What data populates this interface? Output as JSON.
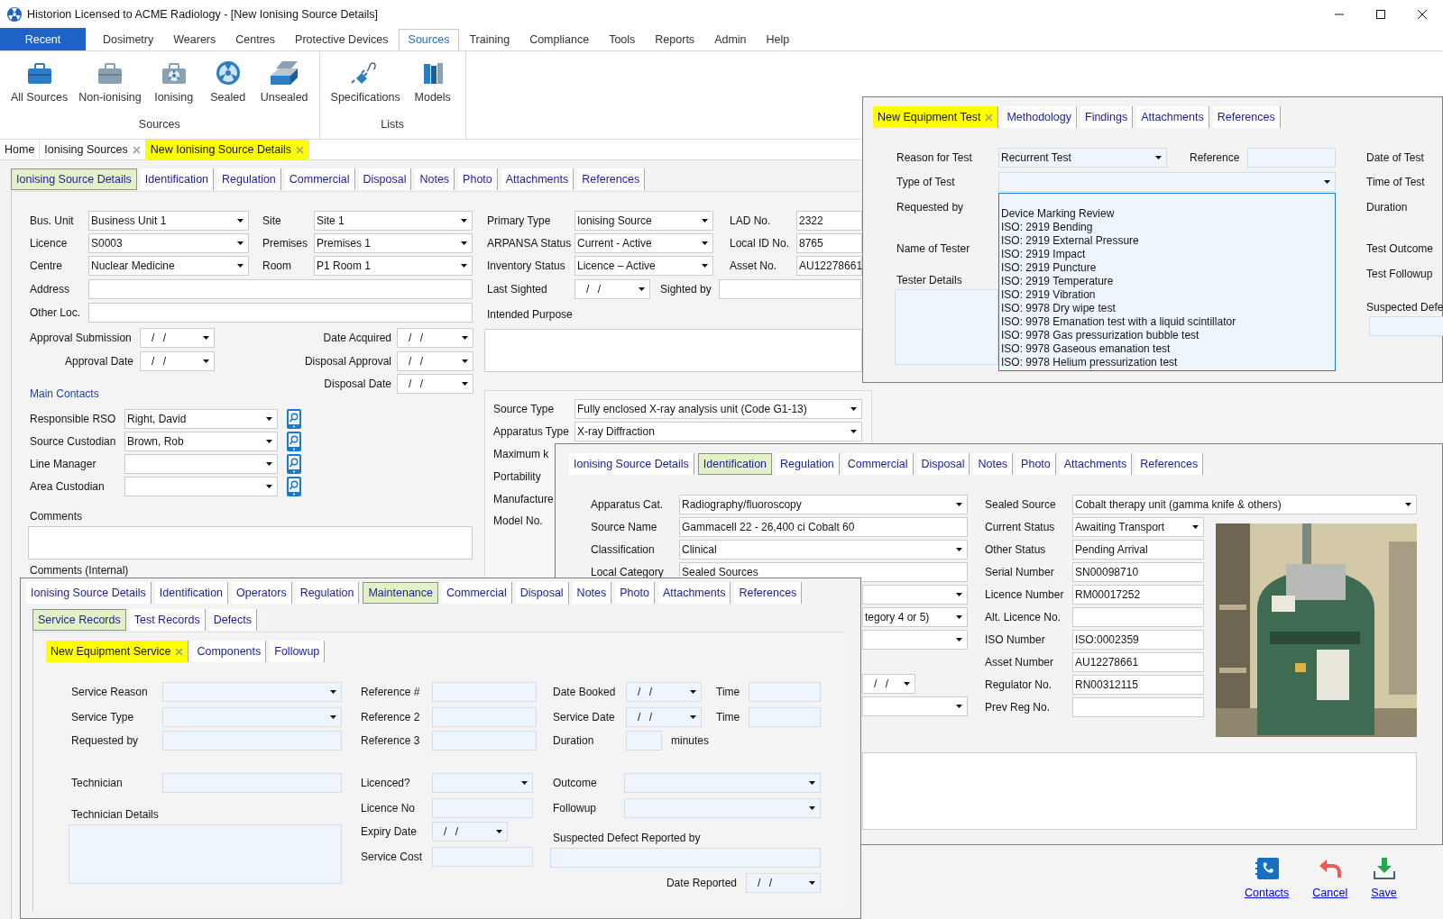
{
  "window": {
    "title": "Historion Licensed to ACME Radiology - [New Ionising Source Details]"
  },
  "menu": {
    "recent": "Recent",
    "tabs": [
      {
        "label": "Dosimetry",
        "selected": false
      },
      {
        "label": "Wearers",
        "selected": false
      },
      {
        "label": "Centres",
        "selected": false
      },
      {
        "label": "Protective Devices",
        "selected": false
      },
      {
        "label": "Sources",
        "selected": true
      },
      {
        "label": "Training",
        "selected": false
      },
      {
        "label": "Compliance",
        "selected": false
      },
      {
        "label": "Tools",
        "selected": false
      },
      {
        "label": "Reports",
        "selected": false
      },
      {
        "label": "Admin",
        "selected": false
      },
      {
        "label": "Help",
        "selected": false
      }
    ]
  },
  "ribbon": {
    "groups": [
      {
        "label": "Sources",
        "items": [
          {
            "label": "All Sources"
          },
          {
            "label": "Non-ionising"
          },
          {
            "label": "Ionising"
          },
          {
            "label": "Sealed"
          },
          {
            "label": "Unsealed"
          }
        ]
      },
      {
        "label": "Lists",
        "items": [
          {
            "label": "Specifications"
          },
          {
            "label": "Models"
          }
        ]
      }
    ]
  },
  "document_tabs": [
    {
      "label": "Home",
      "closable": false,
      "selected": false
    },
    {
      "label": "Ionising Sources",
      "closable": true,
      "selected": false
    },
    {
      "label": "New Ionising Source Details",
      "closable": true,
      "selected": true
    }
  ],
  "source_form": {
    "tabs": [
      {
        "label": "Ionising Source Details",
        "selected": true
      },
      {
        "label": "Identification",
        "selected": false
      },
      {
        "label": "Regulation",
        "selected": false
      },
      {
        "label": "Commercial",
        "selected": false
      },
      {
        "label": "Disposal",
        "selected": false
      },
      {
        "label": "Notes",
        "selected": false
      },
      {
        "label": "Photo",
        "selected": false
      },
      {
        "label": "Attachments",
        "selected": false
      },
      {
        "label": "References",
        "selected": false
      }
    ],
    "fields": [
      {
        "label": "Bus. Unit",
        "kind": "combo",
        "value": "Business Unit 1"
      },
      {
        "label": "Site",
        "kind": "combo",
        "value": "Site 1"
      },
      {
        "label": "Primary Type",
        "kind": "combo",
        "value": "Ionising Source"
      },
      {
        "label": "LAD No.",
        "kind": "text",
        "value": "2322"
      },
      {
        "label": "Licence",
        "kind": "combo",
        "value": "S0003"
      },
      {
        "label": "Premises",
        "kind": "combo",
        "value": "Premises 1"
      },
      {
        "label": "ARPANSA Status",
        "kind": "combo",
        "value": "Current - Active"
      },
      {
        "label": "Local ID No.",
        "kind": "text",
        "value": "8765"
      },
      {
        "label": "Centre",
        "kind": "combo",
        "value": "Nuclear Medicine"
      },
      {
        "label": "Room",
        "kind": "combo",
        "value": "P1 Room 1"
      },
      {
        "label": "Inventory Status",
        "kind": "combo",
        "value": "Licence – Active"
      },
      {
        "label": "Asset No.",
        "kind": "text",
        "value": "AU12278661"
      },
      {
        "label": "Address",
        "kind": "text"
      },
      {
        "label": "Last Sighted",
        "kind": "date",
        "value": "/ /"
      },
      {
        "label": "Sighted by",
        "kind": "text"
      },
      {
        "label": "Other Loc.",
        "kind": "text"
      },
      {
        "label": "Intended Purpose",
        "kind": "area"
      },
      {
        "label": "Approval Submission",
        "kind": "date",
        "value": "/ /"
      },
      {
        "label": "Date Acquired",
        "kind": "date",
        "value": "/ /"
      },
      {
        "label": "Approval Date",
        "kind": "date",
        "value": "/ /"
      },
      {
        "label": "Disposal Approval",
        "kind": "date",
        "value": "/ /"
      },
      {
        "label": "Disposal Date",
        "kind": "date",
        "value": "/ /"
      },
      {
        "label": "Comments",
        "kind": "area"
      },
      {
        "label": "Comments (Internal)",
        "kind": "label"
      }
    ],
    "contacts_heading": "Main Contacts",
    "contacts": [
      {
        "label": "Responsible RSO",
        "value": "Right, David"
      },
      {
        "label": "Source Custodian",
        "value": "Brown, Rob"
      },
      {
        "label": "Line Manager"
      },
      {
        "label": "Area Custodian"
      }
    ],
    "apparatus_fields": [
      {
        "label": "Source Type",
        "kind": "combo",
        "value": "Fully enclosed X-ray analysis unit (Code G1-13)"
      },
      {
        "label": "Apparatus Type",
        "kind": "combo",
        "value": "X-ray Diffraction"
      },
      {
        "label": "Maximum k",
        "kind": "label"
      },
      {
        "label": "Portability",
        "kind": "label"
      },
      {
        "label": "Manufacture",
        "kind": "label"
      },
      {
        "label": "Model No.",
        "kind": "label"
      }
    ]
  },
  "test_window": {
    "tabs": [
      {
        "label": "New Equipment Test",
        "closable": true,
        "selected": true
      },
      {
        "label": "Methodology",
        "closable": false,
        "selected": false
      },
      {
        "label": "Findings",
        "closable": false,
        "selected": false
      },
      {
        "label": "Attachments",
        "closable": false,
        "selected": false
      },
      {
        "label": "References",
        "closable": false,
        "selected": false
      }
    ],
    "fields": [
      {
        "label": "Reason for Test",
        "kind": "combo",
        "value": "Recurrent Test"
      },
      {
        "label": "Reference",
        "kind": "text"
      },
      {
        "label": "Date of Test",
        "kind": "label"
      },
      {
        "label": "Type of Test",
        "kind": "combo"
      },
      {
        "label": "Time of Test",
        "kind": "label"
      },
      {
        "label": "Requested by",
        "kind": "label"
      },
      {
        "label": "Duration",
        "kind": "label"
      },
      {
        "label": "Name of Tester",
        "kind": "label"
      },
      {
        "label": "Test Outcome",
        "kind": "label"
      },
      {
        "label": "Tester Details",
        "kind": "area"
      },
      {
        "label": "Test Followup",
        "kind": "label"
      },
      {
        "label": "Suspected Defe",
        "kind": "text"
      }
    ],
    "type_options": [
      "Device Marking Review",
      "ISO: 2919 Bending",
      "ISO: 2919 External Pressure",
      "ISO: 2919 Impact",
      "ISO: 2919 Puncture",
      "ISO: 2919 Temperature",
      "ISO: 2919 Vibration",
      "ISO: 9978 Dry wipe test",
      "ISO: 9978 Emanation test with a liquid scintillator",
      "ISO: 9978 Gas pressurization bubble test",
      "ISO: 9978 Gaseous emanation test",
      "ISO: 9978 Helium pressurization test"
    ]
  },
  "identification_window": {
    "tabs": [
      {
        "label": "Ionising Source Details",
        "selected": false
      },
      {
        "label": "Identification",
        "selected": true
      },
      {
        "label": "Regulation",
        "selected": false
      },
      {
        "label": "Commercial",
        "selected": false
      },
      {
        "label": "Disposal",
        "selected": false
      },
      {
        "label": "Notes",
        "selected": false
      },
      {
        "label": "Photo",
        "selected": false
      },
      {
        "label": "Attachments",
        "selected": false
      },
      {
        "label": "References",
        "selected": false
      }
    ],
    "fields": [
      {
        "label": "Apparatus Cat.",
        "kind": "combo",
        "value": "Radiography/fluoroscopy"
      },
      {
        "label": "Source Name",
        "kind": "text",
        "value": "Gammacell 22 - 26,400 ci Cobalt 60"
      },
      {
        "label": "Classification",
        "kind": "combo",
        "value": "Clinical"
      },
      {
        "label": "Local Category",
        "kind": "text",
        "value": "Sealed Sources"
      },
      {
        "kind": "combo"
      },
      {
        "kind": "combo",
        "value": "tegory 4 or 5)"
      },
      {
        "kind": "combo"
      },
      {
        "kind": "date",
        "value": "/ /"
      },
      {
        "kind": "combo"
      },
      {
        "label": "Sealed Source",
        "kind": "combo",
        "value": "Cobalt therapy unit (gamma knife & others)"
      },
      {
        "label": "Current Status",
        "kind": "combo",
        "value": "Awaiting Transport"
      },
      {
        "label": "Other Status",
        "kind": "text",
        "value": "Pending Arrival"
      },
      {
        "label": "Serial Number",
        "kind": "text",
        "value": "SN00098710"
      },
      {
        "label": "Licence Number",
        "kind": "text",
        "value": "RM00017252"
      },
      {
        "label": "Alt. Licence No.",
        "kind": "text"
      },
      {
        "label": "ISO Number",
        "kind": "text",
        "value": "ISO:0002359"
      },
      {
        "label": "Asset Number",
        "kind": "text",
        "value": "AU12278661"
      },
      {
        "label": "Regulator No.",
        "kind": "text",
        "value": "RN00312115"
      },
      {
        "label": "Prev Reg No.",
        "kind": "text"
      },
      {
        "kind": "area"
      }
    ]
  },
  "maintenance_window": {
    "tabs": [
      {
        "label": "Ionising Source Details",
        "selected": false
      },
      {
        "label": "Identification",
        "selected": false
      },
      {
        "label": "Operators",
        "selected": false
      },
      {
        "label": "Regulation",
        "selected": false
      },
      {
        "label": "Maintenance",
        "selected": true
      },
      {
        "label": "Commercial",
        "selected": false
      },
      {
        "label": "Disposal",
        "selected": false
      },
      {
        "label": "Notes",
        "selected": false
      },
      {
        "label": "Photo",
        "selected": false
      },
      {
        "label": "Attachments",
        "selected": false
      },
      {
        "label": "References",
        "selected": false
      }
    ],
    "subtabs": [
      {
        "label": "Service Records",
        "selected": true
      },
      {
        "label": "Test Records",
        "selected": false
      },
      {
        "label": "Defects",
        "selected": false
      }
    ],
    "record_tabs": [
      {
        "label": "New Equipment Service",
        "closable": true,
        "selected": true
      },
      {
        "label": "Components",
        "closable": false,
        "selected": false
      },
      {
        "label": "Followup",
        "closable": false,
        "selected": false
      }
    ],
    "fields": [
      {
        "label": "Service Reason",
        "kind": "combo"
      },
      {
        "label": "Service Type",
        "kind": "combo"
      },
      {
        "label": "Requested by",
        "kind": "text"
      },
      {
        "label": "Technician",
        "kind": "text"
      },
      {
        "label": "Technician Details",
        "kind": "area"
      },
      {
        "label": "Reference #",
        "kind": "text"
      },
      {
        "label": "Reference 2",
        "kind": "text"
      },
      {
        "label": "Reference 3",
        "kind": "text"
      },
      {
        "label": "Licenced?",
        "kind": "combo"
      },
      {
        "label": "Licence No",
        "kind": "text"
      },
      {
        "label": "Expiry Date",
        "kind": "date",
        "value": "/ /"
      },
      {
        "label": "Service Cost",
        "kind": "text"
      },
      {
        "label": "Date Booked",
        "kind": "date",
        "value": "/ /"
      },
      {
        "label": "Time",
        "kind": "text"
      },
      {
        "label": "Service Date",
        "kind": "date",
        "value": "/ /"
      },
      {
        "label": "Time",
        "kind": "text"
      },
      {
        "label": "Duration",
        "kind": "text",
        "suffix": "minutes"
      },
      {
        "label": "Outcome",
        "kind": "combo"
      },
      {
        "label": "Followup",
        "kind": "combo"
      },
      {
        "label": "Suspected Defect Reported by",
        "kind": "text"
      },
      {
        "label": "Date Reported",
        "kind": "date",
        "value": "/ /"
      }
    ]
  },
  "actions": [
    {
      "label": "Contacts"
    },
    {
      "label": "Cancel"
    },
    {
      "label": "Save"
    }
  ]
}
